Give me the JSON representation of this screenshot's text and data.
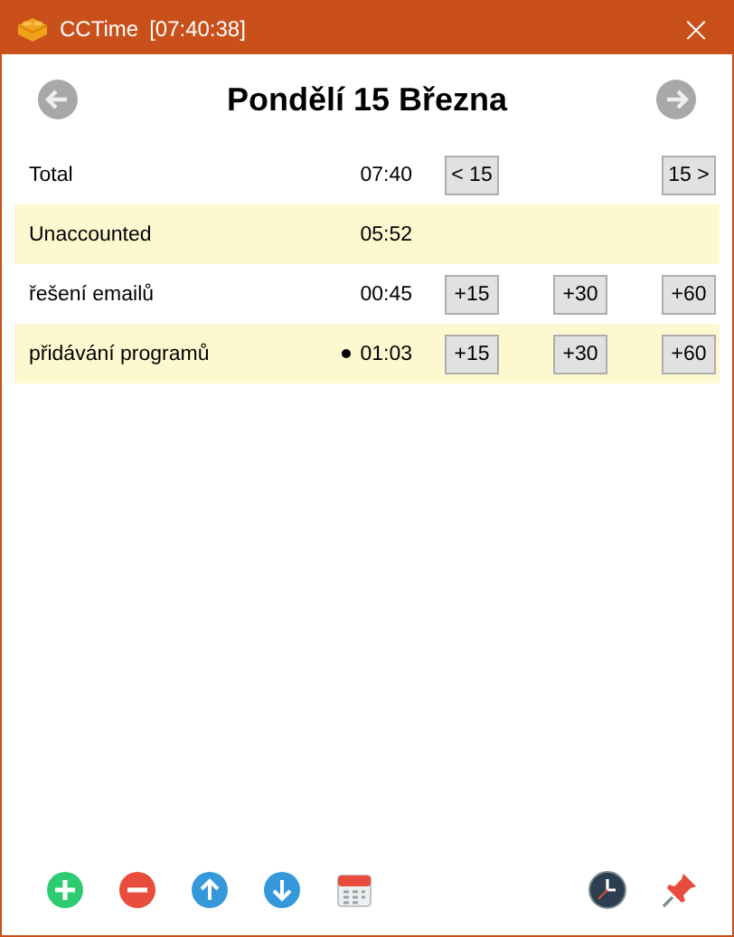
{
  "window": {
    "title": "CCTime",
    "clock": "[07:40:38]",
    "close": "×"
  },
  "header": {
    "date": "Pondělí 15 Března"
  },
  "rows": [
    {
      "kind": "total",
      "name": "Total",
      "time": "07:40",
      "active": false,
      "buttons": [
        "< 15",
        "15 >"
      ]
    },
    {
      "kind": "unaccounted",
      "name": "Unaccounted",
      "time": "05:52",
      "active": false
    },
    {
      "kind": "task",
      "name": "řešení emailů",
      "time": "00:45",
      "active": false,
      "buttons": [
        "+15",
        "+30",
        "+60"
      ]
    },
    {
      "kind": "task",
      "name": "přidávání programů",
      "time": "01:03",
      "active": true,
      "buttons": [
        "+15",
        "+30",
        "+60"
      ]
    }
  ]
}
